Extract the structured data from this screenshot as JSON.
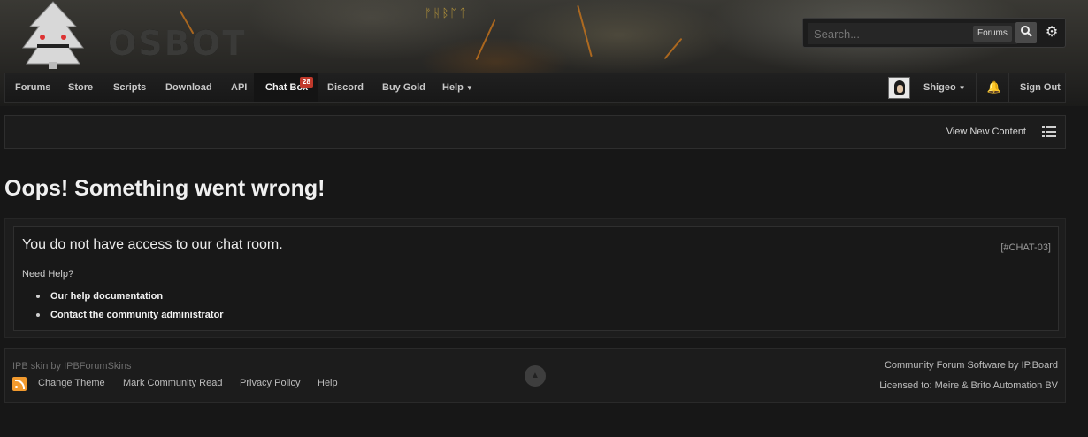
{
  "header": {
    "logo_text": "OSBOT",
    "runes": "ᚠᚺᛒᛖᛏ",
    "search": {
      "placeholder": "Search...",
      "scope_label": "Forums",
      "search_icon": "magnifier-icon",
      "settings_icon": "gear-icon"
    }
  },
  "nav": {
    "items": [
      {
        "label": "Forums"
      },
      {
        "label": "Store"
      },
      {
        "label": "Scripts"
      },
      {
        "label": "Download"
      },
      {
        "label": "API"
      },
      {
        "label": "Chat Box",
        "badge": "28",
        "active": true
      },
      {
        "label": "Discord"
      },
      {
        "label": "Buy Gold"
      },
      {
        "label": "Help",
        "has_dropdown": true
      }
    ],
    "user": {
      "name": "Shigeo",
      "has_dropdown": true
    },
    "notifications_icon": "bell-icon",
    "sign_out": "Sign Out"
  },
  "toolbar": {
    "view_new_content": "View New Content",
    "list_icon": "list-icon"
  },
  "main": {
    "title": "Oops! Something went wrong!",
    "error": {
      "message": "You do not have access to our chat room.",
      "code": "[#CHAT-03]",
      "need_help": "Need Help?",
      "help_links": [
        "Our help documentation",
        "Contact the community administrator"
      ]
    }
  },
  "footer": {
    "skin_credit": "IPB skin by IPBForumSkins",
    "rss_icon": "rss-icon",
    "links": [
      "Change Theme",
      "Mark Community Read",
      "Privacy Policy",
      "Help"
    ],
    "back_to_top_icon": "arrow-up-icon",
    "software": "Community Forum Software by IP.Board",
    "licensed": "Licensed to: Meire & Brito Automation BV"
  },
  "colors": {
    "background": "#171717",
    "badge": "#c0392b",
    "bell": "#e2b43b",
    "rss": "#f29a2e",
    "logo_accent": "#6f9a3c"
  }
}
